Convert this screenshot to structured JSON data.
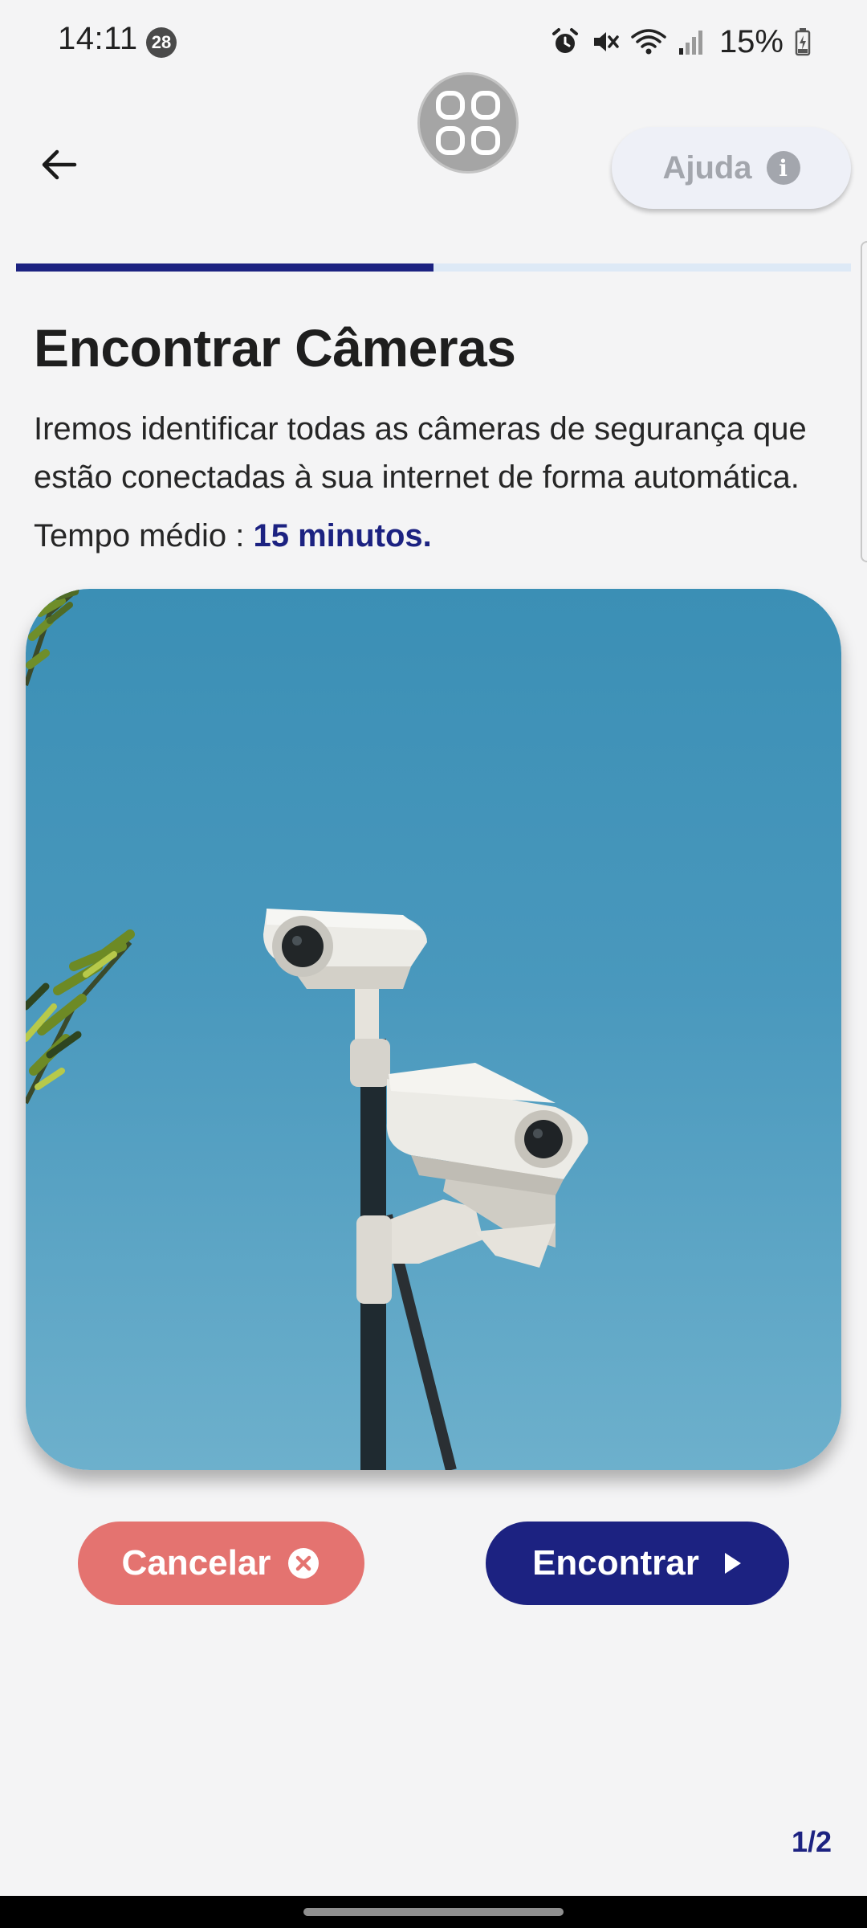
{
  "status_bar": {
    "time": "14:11",
    "notification_count": "28",
    "battery": "15%"
  },
  "header": {
    "help_label": "Ajuda",
    "help_icon": "info-icon",
    "back_icon": "arrow-left-icon",
    "logo_icon": "grid-app-icon"
  },
  "progress": {
    "fraction": 0.5,
    "fill_color": "#1c2281",
    "track_color": "#dde9f6"
  },
  "content": {
    "title": "Encontrar Câmeras",
    "description": "Iremos identificar todas as câmeras de segurança que estão conectadas à sua internet de forma automática.",
    "avg_time_label": "Tempo médio : ",
    "avg_time_value": "15 minutos."
  },
  "actions": {
    "cancel_label": "Cancelar",
    "cancel_icon": "close-circle-icon",
    "cancel_color": "#e47370",
    "find_label": "Encontrar",
    "find_icon": "play-icon",
    "find_color": "#1c2281"
  },
  "pagination": {
    "indicator": "1/2"
  }
}
